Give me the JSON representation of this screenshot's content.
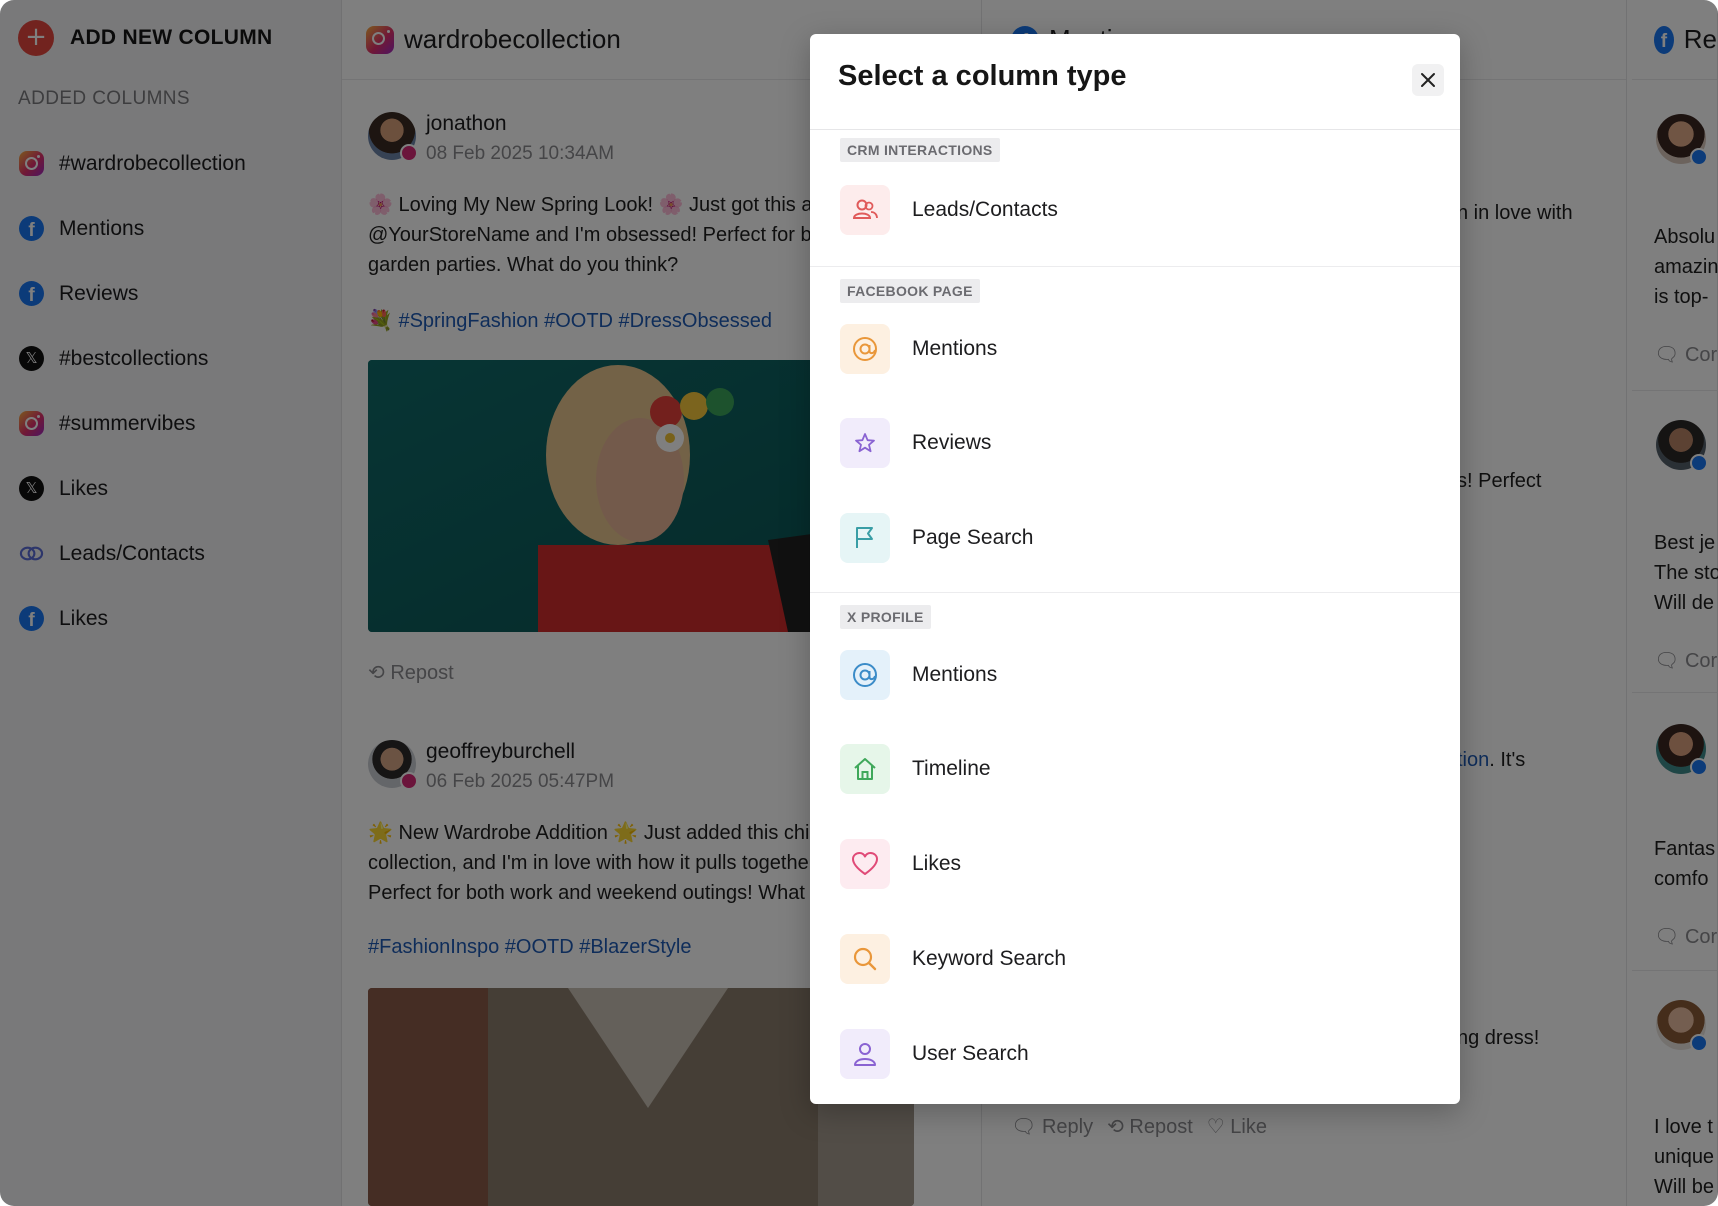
{
  "sidebar": {
    "add_column_label": "ADD NEW COLUMN",
    "added_columns_header": "ADDED COLUMNS",
    "items": [
      {
        "label": "#wardrobecollection",
        "icon": "instagram-icon"
      },
      {
        "label": "Mentions",
        "icon": "facebook-icon"
      },
      {
        "label": "Reviews",
        "icon": "facebook-icon"
      },
      {
        "label": "#bestcollections",
        "icon": "x-icon"
      },
      {
        "label": "#summervibes",
        "icon": "instagram-icon"
      },
      {
        "label": "Likes",
        "icon": "x-icon"
      },
      {
        "label": "Leads/Contacts",
        "icon": "crm-icon"
      },
      {
        "label": "Likes",
        "icon": "facebook-icon"
      }
    ]
  },
  "column1": {
    "title": "wardrobecollection",
    "posts": [
      {
        "user": "jonathon",
        "date": "08 Feb 2025 10:34AM",
        "line1": "🌸 Loving My New Spring Look! 🌸 Just got this ado",
        "line2": "@YourStoreName and I'm obsessed! Perfect for br",
        "line3": "garden parties. What do you think?",
        "tags": "💐 #SpringFashion #OOTD #DressObsessed",
        "repost": "Repost"
      },
      {
        "user": "geoffreyburchell",
        "date": "06 Feb 2025 05:47PM",
        "line1": "🌟 New Wardrobe Addition 🌟 Just added this chic b",
        "line2": "collection, and I'm in love with how it pulls togethe",
        "line3": "Perfect for both work and weekend outings! What d",
        "tags": "#FashionInspo #OOTD #BlazerStyle"
      }
    ]
  },
  "column2": {
    "title": "Mentions",
    "fragments": {
      "f1": "n in love with",
      "f2": "s! Perfect",
      "f3_link": "tion",
      "f3_rest": ". It's",
      "f4": "ng dress!"
    },
    "actions": {
      "reply": "Reply",
      "repost": "Repost",
      "like": "Like"
    }
  },
  "column3": {
    "title": "Re",
    "texts": {
      "a1": "Absolu",
      "a2": "amazin",
      "a3": "is top-",
      "b1": "Best je",
      "b2": "The sto",
      "b3": "Will de",
      "c1": "Fantas",
      "c2": "comfo",
      "d1": "I love t",
      "d2": "unique",
      "d3": "Will be"
    },
    "comment": "Cor"
  },
  "modal": {
    "title": "Select a column type",
    "sections": [
      {
        "label": "CRM INTERACTIONS",
        "options": [
          {
            "label": "Leads/Contacts",
            "icon": "contacts-icon",
            "bg": "#fdecec",
            "color": "#e05a5a"
          }
        ]
      },
      {
        "label": "FACEBOOK PAGE",
        "options": [
          {
            "label": "Mentions",
            "icon": "at-icon",
            "bg": "#fdf0e1",
            "color": "#e9973a"
          },
          {
            "label": "Reviews",
            "icon": "star-icon",
            "bg": "#f1ecfb",
            "color": "#8a63d2"
          },
          {
            "label": "Page Search",
            "icon": "flag-icon",
            "bg": "#e6f5f6",
            "color": "#3a9ea6"
          }
        ]
      },
      {
        "label": "X PROFILE",
        "options": [
          {
            "label": "Mentions",
            "icon": "at-icon",
            "bg": "#e4f1fa",
            "color": "#3b8cc8"
          },
          {
            "label": "Timeline",
            "icon": "home-icon",
            "bg": "#e6f6e9",
            "color": "#3fa85a"
          },
          {
            "label": "Likes",
            "icon": "heart-icon",
            "bg": "#fdebf0",
            "color": "#e04a77"
          },
          {
            "label": "Keyword Search",
            "icon": "search-icon",
            "bg": "#fdf0e1",
            "color": "#e9973a"
          },
          {
            "label": "User Search",
            "icon": "user-icon",
            "bg": "#f1ecfb",
            "color": "#8a63d2"
          }
        ]
      }
    ]
  }
}
